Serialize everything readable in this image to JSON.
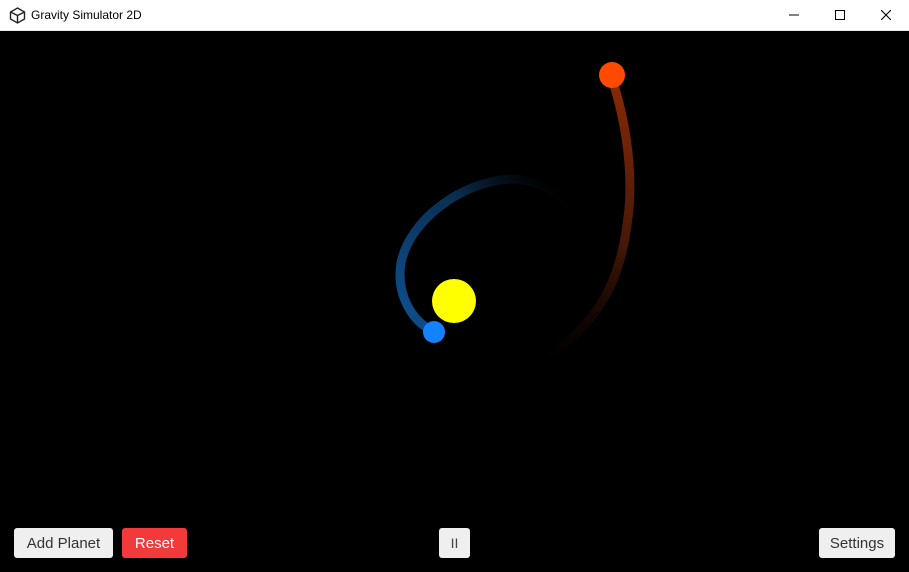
{
  "window": {
    "title": "Gravity Simulator 2D",
    "app_icon": "unity-logo-icon",
    "controls": [
      "minimize-icon",
      "maximize-icon",
      "close-icon"
    ]
  },
  "scene": {
    "background_color": "#000000",
    "bodies": [
      {
        "name": "sun",
        "color": "#ffff00"
      },
      {
        "name": "blue-planet",
        "color": "#1482ff",
        "trail_color": "#0c3a66"
      },
      {
        "name": "orange-planet",
        "color": "#ff4a00",
        "trail_color": "#6e1e05"
      }
    ]
  },
  "controls": {
    "add_planet": "Add Planet",
    "reset": "Reset",
    "pause": "II",
    "settings": "Settings"
  },
  "colors": {
    "reset_button": "#f23a3a",
    "button_bg": "#efefef"
  }
}
